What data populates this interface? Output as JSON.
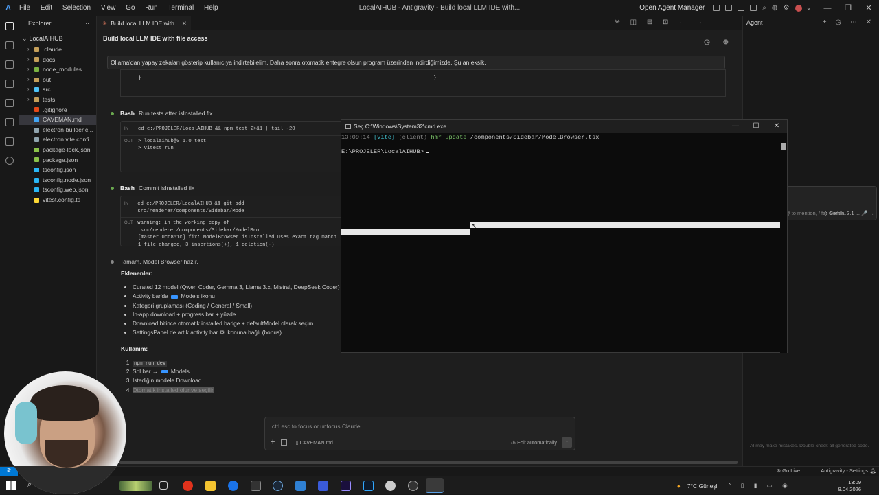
{
  "titlebar": {
    "menu": [
      "File",
      "Edit",
      "Selection",
      "View",
      "Go",
      "Run",
      "Terminal",
      "Help"
    ],
    "title": "LocalAIHUB - Antigravity - Build local LLM IDE with...",
    "open_agent_manager": "Open Agent Manager"
  },
  "explorer": {
    "header": "Explorer",
    "root": "LocalAIHUB",
    "items": [
      {
        "name": ".claude",
        "type": "folder",
        "color": "#c5a05a"
      },
      {
        "name": "docs",
        "type": "folder",
        "color": "#c5a05a"
      },
      {
        "name": "node_modules",
        "type": "folder",
        "color": "#7cb342"
      },
      {
        "name": "out",
        "type": "folder",
        "color": "#c5a05a"
      },
      {
        "name": "src",
        "type": "folder",
        "color": "#4fc3f7"
      },
      {
        "name": "tests",
        "type": "folder",
        "color": "#c5a05a"
      },
      {
        "name": ".gitignore",
        "type": "file",
        "color": "#e64a19"
      },
      {
        "name": "CAVEMAN.md",
        "type": "file",
        "color": "#42a5f5"
      },
      {
        "name": "electron-builder.c...",
        "type": "file",
        "color": "#90a4ae"
      },
      {
        "name": "electron.vite.confi...",
        "type": "file",
        "color": "#90a4ae"
      },
      {
        "name": "package-lock.json",
        "type": "file",
        "color": "#8bc34a"
      },
      {
        "name": "package.json",
        "type": "file",
        "color": "#8bc34a"
      },
      {
        "name": "tsconfig.json",
        "type": "file",
        "color": "#29b6f6"
      },
      {
        "name": "tsconfig.node.json",
        "type": "file",
        "color": "#29b6f6"
      },
      {
        "name": "tsconfig.web.json",
        "type": "file",
        "color": "#29b6f6"
      },
      {
        "name": "vitest.config.ts",
        "type": "file",
        "color": "#fdd835"
      }
    ]
  },
  "editor": {
    "tab_label": "Build local LLM IDE with...",
    "conversation_title": "Build local LLM IDE with file access",
    "user_message": "Ollama'dan yapay zekaları gösterip kullanıcıya indirtebilelim. Daha sonra otomatik entegre olsun program üzerinden indirdiğimizde. Şu an eksik.",
    "steps": [
      {
        "tool": "Bash",
        "desc": "Run tests after isInstalled fix",
        "in": "cd e:/PROJELER/LocalAIHUB && npm test 2>&1 | tail -20",
        "out": [
          "> localaihub@0.1.0 test",
          "> vitest run"
        ]
      },
      {
        "tool": "Bash",
        "desc": "Commit isInstalled fix",
        "in": "cd e:/PROJELER/LocalAIHUB && git add src/renderer/components/Sidebar/Mode",
        "out": [
          "warning: in the working copy of 'src/renderer/components/Sidebar/ModelBro",
          "[master 0cd851c] fix: ModelBrowser isInstalled uses exact tag match",
          " 1 file changed, 3 insertions(+), 1 deletion(-)"
        ]
      }
    ],
    "answer": {
      "intro": "Tamam. Model Browser hazır.",
      "added_title": "Eklenenler:",
      "added": [
        "Curated 12 model (Qwen Coder, Gemma 3, Llama 3.x, Mistral, DeepSeek Coder)",
        "Activity bar'da",
        "Models ikonu",
        "Kategori gruplaması (Coding / General / Small)",
        "In-app download + progress bar + yüzde",
        "Download bitince otomatik installed badge + defaultModel olarak seçim",
        "SettingsPanel de artık activity bar ⚙ ikonuna bağlı (bonus)"
      ],
      "usage_title": "Kullanım:",
      "usage": {
        "step1_code": "npm run dev",
        "step2_prefix": "Sol bar →",
        "step2_suffix": "Models",
        "step3": "İstediğin modele Download",
        "step4": "Otomatik installed olur ve seçilir"
      }
    },
    "input": {
      "placeholder": "ctrl esc to focus or unfocus Claude",
      "file": "CAVEMAN.md",
      "mode": "Edit automatically"
    }
  },
  "cmd": {
    "title": "Seç C:\\Windows\\System32\\cmd.exe",
    "time": "13:09:14",
    "vite": "[vite]",
    "client": "(client)",
    "hmr": "hmr update",
    "path": "/components/Sidebar/ModelBrowser.tsx",
    "prompt": "E:\\PROJELER\\LocalAIHUB>"
  },
  "agent": {
    "title": "Agent",
    "badge": "3",
    "placeholder": "@ to mention, / for workfl...",
    "model": "Gemini 3.1 ...",
    "footer": "AI may make mistakes. Double-check all generated code."
  },
  "statusbar": {
    "golive": "Go Live",
    "settings": "Antigravity - Settings"
  },
  "taskbar": {
    "weather": "7°C  Güneşli",
    "time": "13:09",
    "date": "9.04.2026"
  }
}
